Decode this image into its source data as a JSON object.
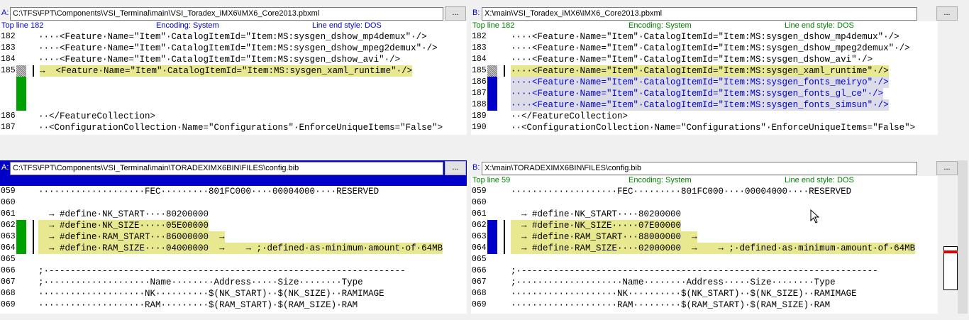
{
  "top": {
    "left": {
      "side": "A:",
      "path": "C:\\TFS\\FPT\\Components\\VSI_Terminal\\main\\VSI_Toradex_iMX6\\IMX6_Core2013.pbxml",
      "browse": "...",
      "status_topline": "Top line 182",
      "status_encoding": "Encoding: System",
      "status_lineend": "Line end style: DOS",
      "lines": [
        {
          "n": "182",
          "text": "····<Feature·Name=\"Item\"·CatalogItemId=\"Item:MS:sysgen_dshow_mp4demux\"·/>"
        },
        {
          "n": "183",
          "text": "····<Feature·Name=\"Item\"·CatalogItemId=\"Item:MS:sysgen_dshow_mpeg2demux\"·/>"
        },
        {
          "n": "184",
          "text": "····<Feature·Name=\"Item\"·CatalogItemId=\"Item:MS:sysgen_dshow_avi\"·/>"
        },
        {
          "n": "185",
          "text": "→  <Feature·Name=\"Item\"·CatalogItemId=\"Item:MS:sysgen_xaml_runtime\"·/>"
        },
        {
          "n": "186",
          "text": "··</FeatureCollection>"
        },
        {
          "n": "187",
          "text": "··<ConfigurationCollection·Name=\"Configurations\"·EnforceUniqueItems=\"False\">"
        }
      ]
    },
    "right": {
      "side": "B:",
      "path": "X:\\main\\VSI_Toradex_iMX6\\IMX6_Core2013.pbxml",
      "browse": "...",
      "status_topline": "Top line 182",
      "status_encoding": "Encoding: System",
      "status_lineend": "Line end style: DOS",
      "lines": [
        {
          "n": "182",
          "text": "····<Feature·Name=\"Item\"·CatalogItemId=\"Item:MS:sysgen_dshow_mp4demux\"·/>"
        },
        {
          "n": "183",
          "text": "····<Feature·Name=\"Item\"·CatalogItemId=\"Item:MS:sysgen_dshow_mpeg2demux\"·/>"
        },
        {
          "n": "184",
          "text": "····<Feature·Name=\"Item\"·CatalogItemId=\"Item:MS:sysgen_dshow_avi\"·/>"
        },
        {
          "n": "185",
          "text": "····<Feature·Name=\"Item\"·CatalogItemId=\"Item:MS:sysgen_xaml_runtime\"·/>"
        },
        {
          "n": "186",
          "text": "····<Feature·Name=\"Item\"·CatalogItemId=\"Item:MS:sysgen_fonts_meiryo\"·/>"
        },
        {
          "n": "187",
          "text": "····<Feature·Name=\"Item\"·CatalogItemId=\"Item:MS:sysgen_fonts_gl_ce\"·/>"
        },
        {
          "n": "188",
          "text": "····<Feature·Name=\"Item\"·CatalogItemId=\"Item:MS:sysgen_fonts_simsun\"·/>"
        },
        {
          "n": "189",
          "text": "··</FeatureCollection>"
        },
        {
          "n": "190",
          "text": "··<ConfigurationCollection·Name=\"Configurations\"·EnforceUniqueItems=\"False\">"
        }
      ]
    }
  },
  "bottom": {
    "left": {
      "side": "A:",
      "path": "C:\\TFS\\FPT\\Components\\VSI_Terminal\\main\\TORADEXIMX6BIN\\FILES\\config.bib",
      "browse": "...",
      "status_topline": "Top line 59",
      "status_encoding": "Encoding: System",
      "status_lineend": "Line end style: DOS",
      "lines": [
        {
          "n": "059",
          "text": "····················FEC·········801FC000····00004000····RESERVED"
        },
        {
          "n": "060",
          "text": ""
        },
        {
          "n": "061",
          "text": "  → #define·NK_START····80200000"
        },
        {
          "n": "062",
          "text": "  → #define·NK_SIZE·····05E00000"
        },
        {
          "n": "063",
          "text": "  → #define·RAM_START···86000000  →"
        },
        {
          "n": "064",
          "text": "  → #define·RAM_SIZE····04000000  →    → ;·defined·as·minimum·amount·of·64MB"
        },
        {
          "n": "065",
          "text": ""
        },
        {
          "n": "066",
          "text": ";·-------------------------------------------------------------------"
        },
        {
          "n": "067",
          "text": ";····················Name········Address·····Size········Type"
        },
        {
          "n": "068",
          "text": "····················NK··········$(NK_START)··$(NK_SIZE)··RAMIMAGE"
        },
        {
          "n": "069",
          "text": "····················RAM·········$(RAM_START)·$(RAM_SIZE)·RAM"
        }
      ]
    },
    "right": {
      "side": "B:",
      "path": "X:\\main\\TORADEXIMX6BIN\\FILES\\config.bib",
      "browse": "...",
      "status_topline": "Top line 59",
      "status_encoding": "Encoding: System",
      "status_lineend": "Line end style: DOS",
      "lines": [
        {
          "n": "059",
          "text": "····················FEC·········801FC000····00004000····RESERVED"
        },
        {
          "n": "060",
          "text": ""
        },
        {
          "n": "061",
          "text": "  → #define·NK_START····80200000"
        },
        {
          "n": "062",
          "text": "  → #define·NK_SIZE·····07E00000"
        },
        {
          "n": "063",
          "text": "  → #define·RAM_START···88000000  →"
        },
        {
          "n": "064",
          "text": "  → #define·RAM_SIZE····02000000  →    → ;·defined·as·minimum·amount·of·64MB"
        },
        {
          "n": "065",
          "text": ""
        },
        {
          "n": "066",
          "text": ";·-------------------------------------------------------------------"
        },
        {
          "n": "067",
          "text": ";····················Name········Address·····Size········Type"
        },
        {
          "n": "068",
          "text": "····················NK··········$(NK_START)··$(NK_SIZE)··RAMIMAGE"
        },
        {
          "n": "069",
          "text": "····················RAM·········$(RAM_START)·$(RAM_SIZE)·RAM"
        }
      ]
    }
  },
  "colors": {
    "active_blue": "#0000c8",
    "diff_green": "#00a000",
    "diff_yellow": "#e8e890",
    "diff_inserted": "#dcdce8",
    "scroll_marker_red": "#e00000"
  },
  "icons": [
    "mouse-pointer-icon"
  ]
}
